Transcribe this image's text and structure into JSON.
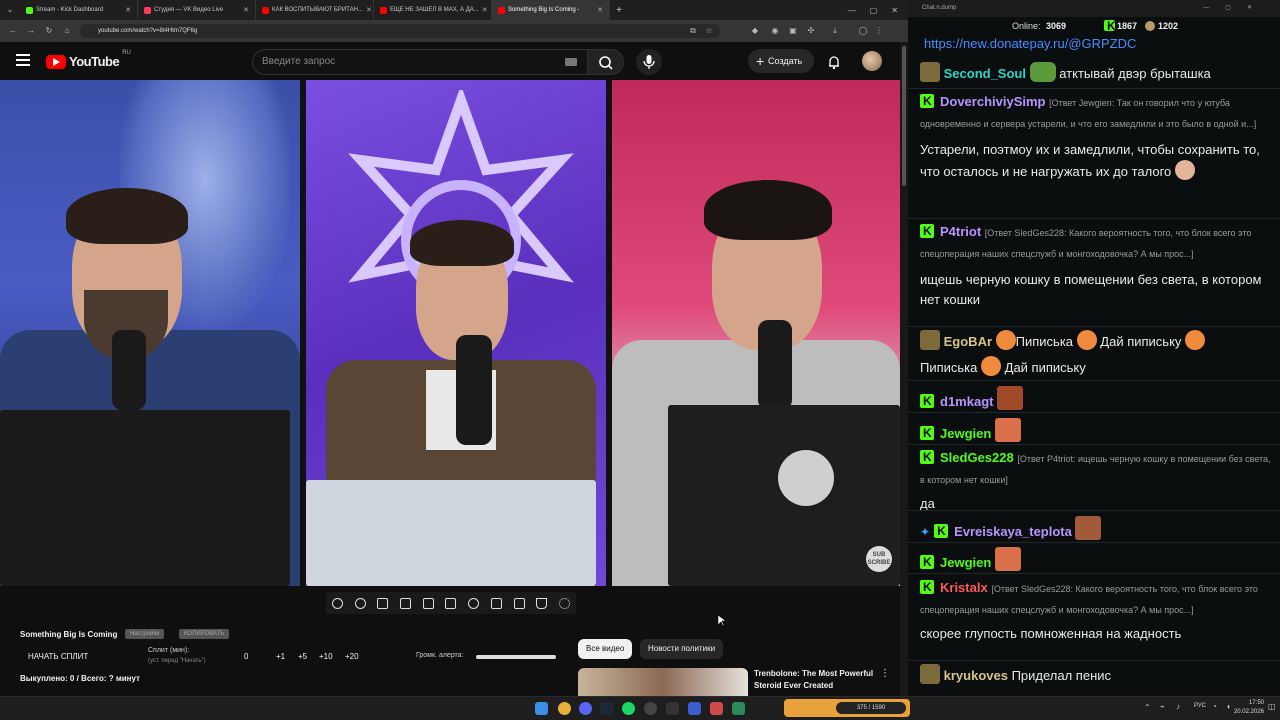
{
  "browser": {
    "tabs": [
      {
        "title": "Stream - Kick Dashboard",
        "color": "#53fc18"
      },
      {
        "title": "Студия — VK Видео Live",
        "color": "#ff3b5c"
      },
      {
        "title": "КАК ВОСПИТЫВАЮТ БРИТАН...",
        "color": "#ff0000"
      },
      {
        "title": "ЕЩЕ НЕ ЗАШЕЛ В MAX, А ДА...",
        "color": "#ff0000"
      },
      {
        "title": "Something Big Is Coming -",
        "color": "#ff0000",
        "active": true
      }
    ],
    "new_tab": "+",
    "url": "youtube.com/watch?v=8t4Htm7QF6g"
  },
  "youtube": {
    "logo_text": "YouTube",
    "logo_region": "RU",
    "search_placeholder": "Введите запрос",
    "create_label": "Создать"
  },
  "video": {
    "subscribe_badge": "SUB SCRIBE"
  },
  "panel": {
    "stream_title": "Something Big Is Coming",
    "setup_pill": "Настройки",
    "copy_pill": "КОПИРОВАТЬ",
    "start_split": "НАЧАТЬ СПЛИТ",
    "split_label": "Сплит (мин):",
    "split_hint": "(уст. перед \"Начать\")",
    "split_value": "0",
    "increments": [
      "+1",
      "+5",
      "+10",
      "+20"
    ],
    "volume_label": "Громк. алерта:",
    "status": "Выкуплено: 0 / Всего: ? минут",
    "tabs": [
      "Все видео",
      "Новости политики"
    ],
    "rec_title": "Trenbolone: The Most Powerful Steroid Ever Created"
  },
  "chat": {
    "window_title": "Chat.n.dump",
    "online_label": "Online:",
    "online_value": "3069",
    "kick_count": "1867",
    "other_count": "1202",
    "link": "https://new.donatepay.ru/@GRPZDC",
    "messages": [
      {
        "user": "Second_Soul",
        "color": "#2fd3c9",
        "reply": "",
        "text": "атктывай двэр брыташка"
      },
      {
        "user": "DoverchiviySimp",
        "color": "#b894ff",
        "reply": "[Ответ Jewgien: Так он говорил что у ютуба одновременно и сервера устарели, и что его замедлили и это было в одной и...]",
        "text": "Устарели, поэтмоу их и замедлили, чтобы сохранить то, что осталось и не нагружать их до талого"
      },
      {
        "user": "P4triot",
        "color": "#b894ff",
        "reply": "[Ответ SledGes228: Какого вероятность того, что блок всего это спецоперация наших спецслужб и монгоходовочка? А мы прос...]",
        "text": "ищешь черную кошку в помещении без света, в котором нет кошки"
      },
      {
        "user": "EgoBAr",
        "color": "#d6c48a",
        "reply": "",
        "text": "Пиписька",
        "text2": "Дай пипиську",
        "text3": "Пиписька",
        "text4": "Дай пипиську"
      },
      {
        "user": "d1mkagt",
        "color": "#b894ff",
        "reply": "",
        "text": ""
      },
      {
        "user": "Jewgien",
        "color": "#53fc18",
        "reply": "",
        "text": ""
      },
      {
        "user": "SledGes228",
        "color": "#53fc18",
        "reply": "[Ответ P4triot: ищешь черную кошку в помещении без света, в котором нет кошки]",
        "text": "да"
      },
      {
        "user": "Evreiskaya_teplota",
        "color": "#b894ff",
        "reply": "",
        "text": ""
      },
      {
        "user": "Jewgien",
        "color": "#53fc18",
        "reply": "",
        "text": ""
      },
      {
        "user": "Kristalx",
        "color": "#ff5a5a",
        "reply": "[Ответ SledGes228: Какого вероятность того, что блок всего это спецоперация наших спецслужб и монгоходовочка? А мы прос...]",
        "text": "скорее глупость помноженная на жадность"
      },
      {
        "user": "kryukoves",
        "color": "#d6c48a",
        "reply": "",
        "text": "Приделал пенис"
      }
    ]
  },
  "taskbar": {
    "media_text": "375 / 1590",
    "lang": "РУС",
    "time": "17:50",
    "date": "20.02.2026"
  },
  "colors": {
    "kick_green": "#53fc18",
    "youtube_red": "#ff0000",
    "bg": "#0f0f0f"
  }
}
